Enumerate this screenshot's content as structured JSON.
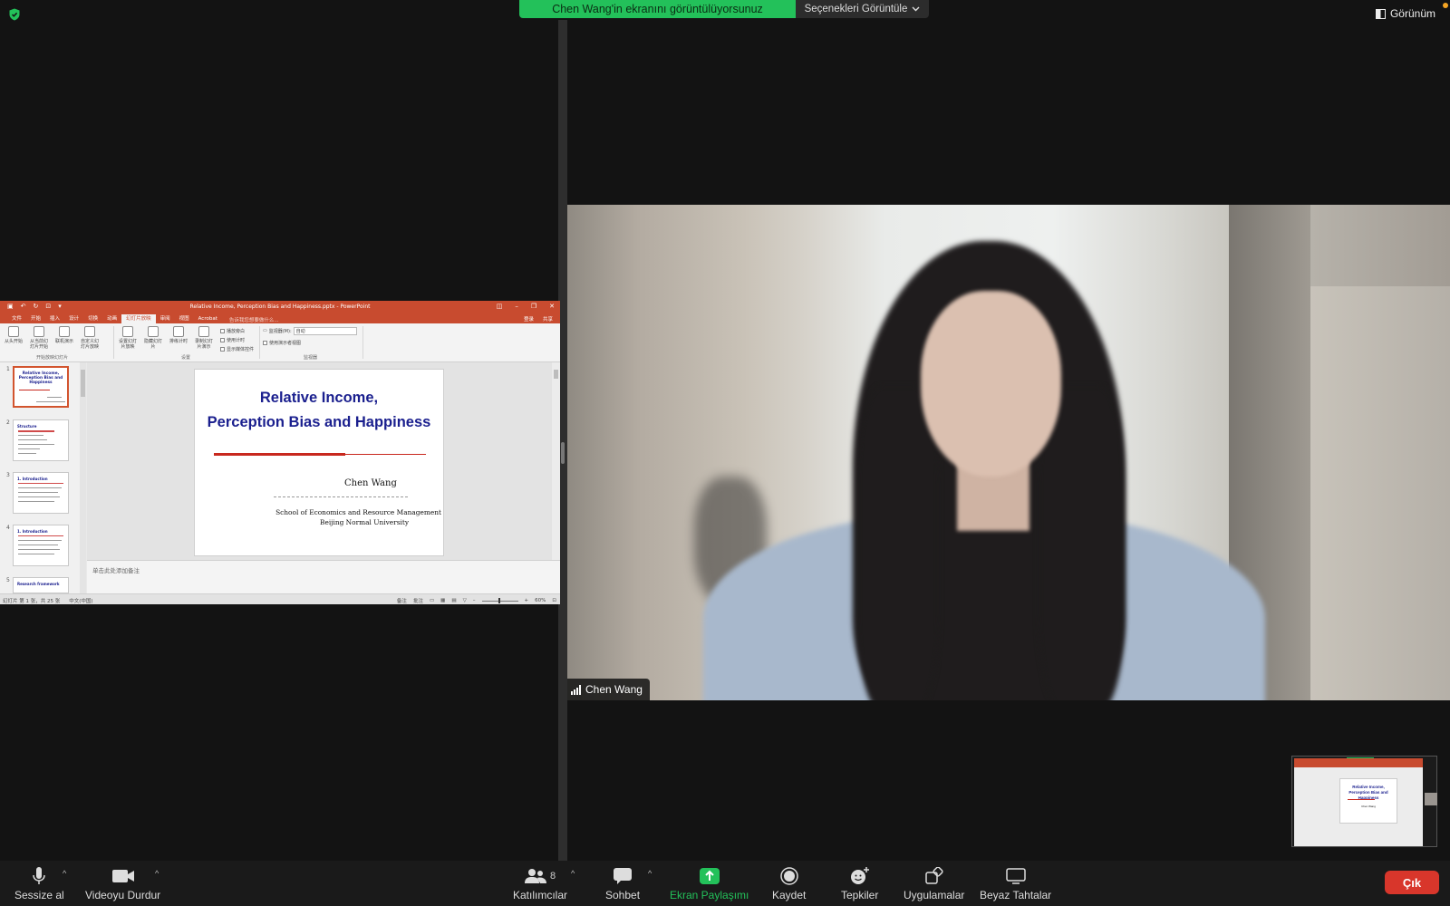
{
  "banner": {
    "sharing_message": "Chen Wang'in ekranını görüntülüyorsunuz",
    "options_label": "Seçenekleri Görüntüle",
    "view_label": "Görünüm"
  },
  "powerpoint": {
    "window_title": "Relative Income, Perception Bias and Happiness.pptx - PowerPoint",
    "tabs": [
      "文件",
      "开始",
      "插入",
      "设计",
      "切换",
      "动画",
      "幻灯片放映",
      "审阅",
      "视图",
      "Acrobat"
    ],
    "tell_me": "告诉我您想要做什么...",
    "sign_in": "登录",
    "share": "共享",
    "ribbon": {
      "buttons": [
        "从头开始",
        "从当前幻灯片开始",
        "联机演示",
        "自定义幻灯片放映",
        "设置幻灯片放映",
        "隐藏幻灯片",
        "排练计时",
        "录制幻灯片演示"
      ],
      "checks": [
        "播放旁白",
        "使用计时",
        "显示媒体控件"
      ],
      "monitor_label": "监视器(M):",
      "monitor_value": "自动",
      "presenter_view": "使用演示者视图",
      "groups": [
        "开始放映幻灯片",
        "设置",
        "监视器"
      ]
    },
    "thumbnails": [
      {
        "num": "1",
        "title": "Relative Income, Perception Bias and Happiness"
      },
      {
        "num": "2",
        "title": "Structure"
      },
      {
        "num": "3",
        "title": "1. Introduction"
      },
      {
        "num": "4",
        "title": "1. Introduction"
      },
      {
        "num": "5",
        "title": "Research framework"
      }
    ],
    "slide": {
      "title_line1": "Relative Income,",
      "title_line2": "Perception Bias and Happiness",
      "author": "Chen Wang",
      "institution_line1": "School of Economics and Resource Management",
      "institution_line2": "Beijing Normal University"
    },
    "notes_placeholder": "单击此处添加备注",
    "status": {
      "slide_count": "幻灯片 第 1 张，共 25 张",
      "language": "中文(中国)",
      "notes": "备注",
      "comments": "批注",
      "zoom": "60%"
    }
  },
  "video": {
    "participant_name": "Chen Wang"
  },
  "toolbar": {
    "mute": "Sessize al",
    "stop_video": "Videoyu Durdur",
    "participants": "Katılımcılar",
    "participants_count": "8",
    "chat": "Sohbet",
    "share_screen": "Ekran Paylaşımı",
    "record": "Kaydet",
    "reactions": "Tepkiler",
    "apps": "Uygulamalar",
    "whiteboards": "Beyaz Tahtalar",
    "leave": "Çık"
  },
  "colors": {
    "share_green": "#23c15a",
    "leave_red": "#d8362b",
    "ppt_accent": "#c84b2f",
    "slide_title_blue": "#1a1f8e"
  }
}
